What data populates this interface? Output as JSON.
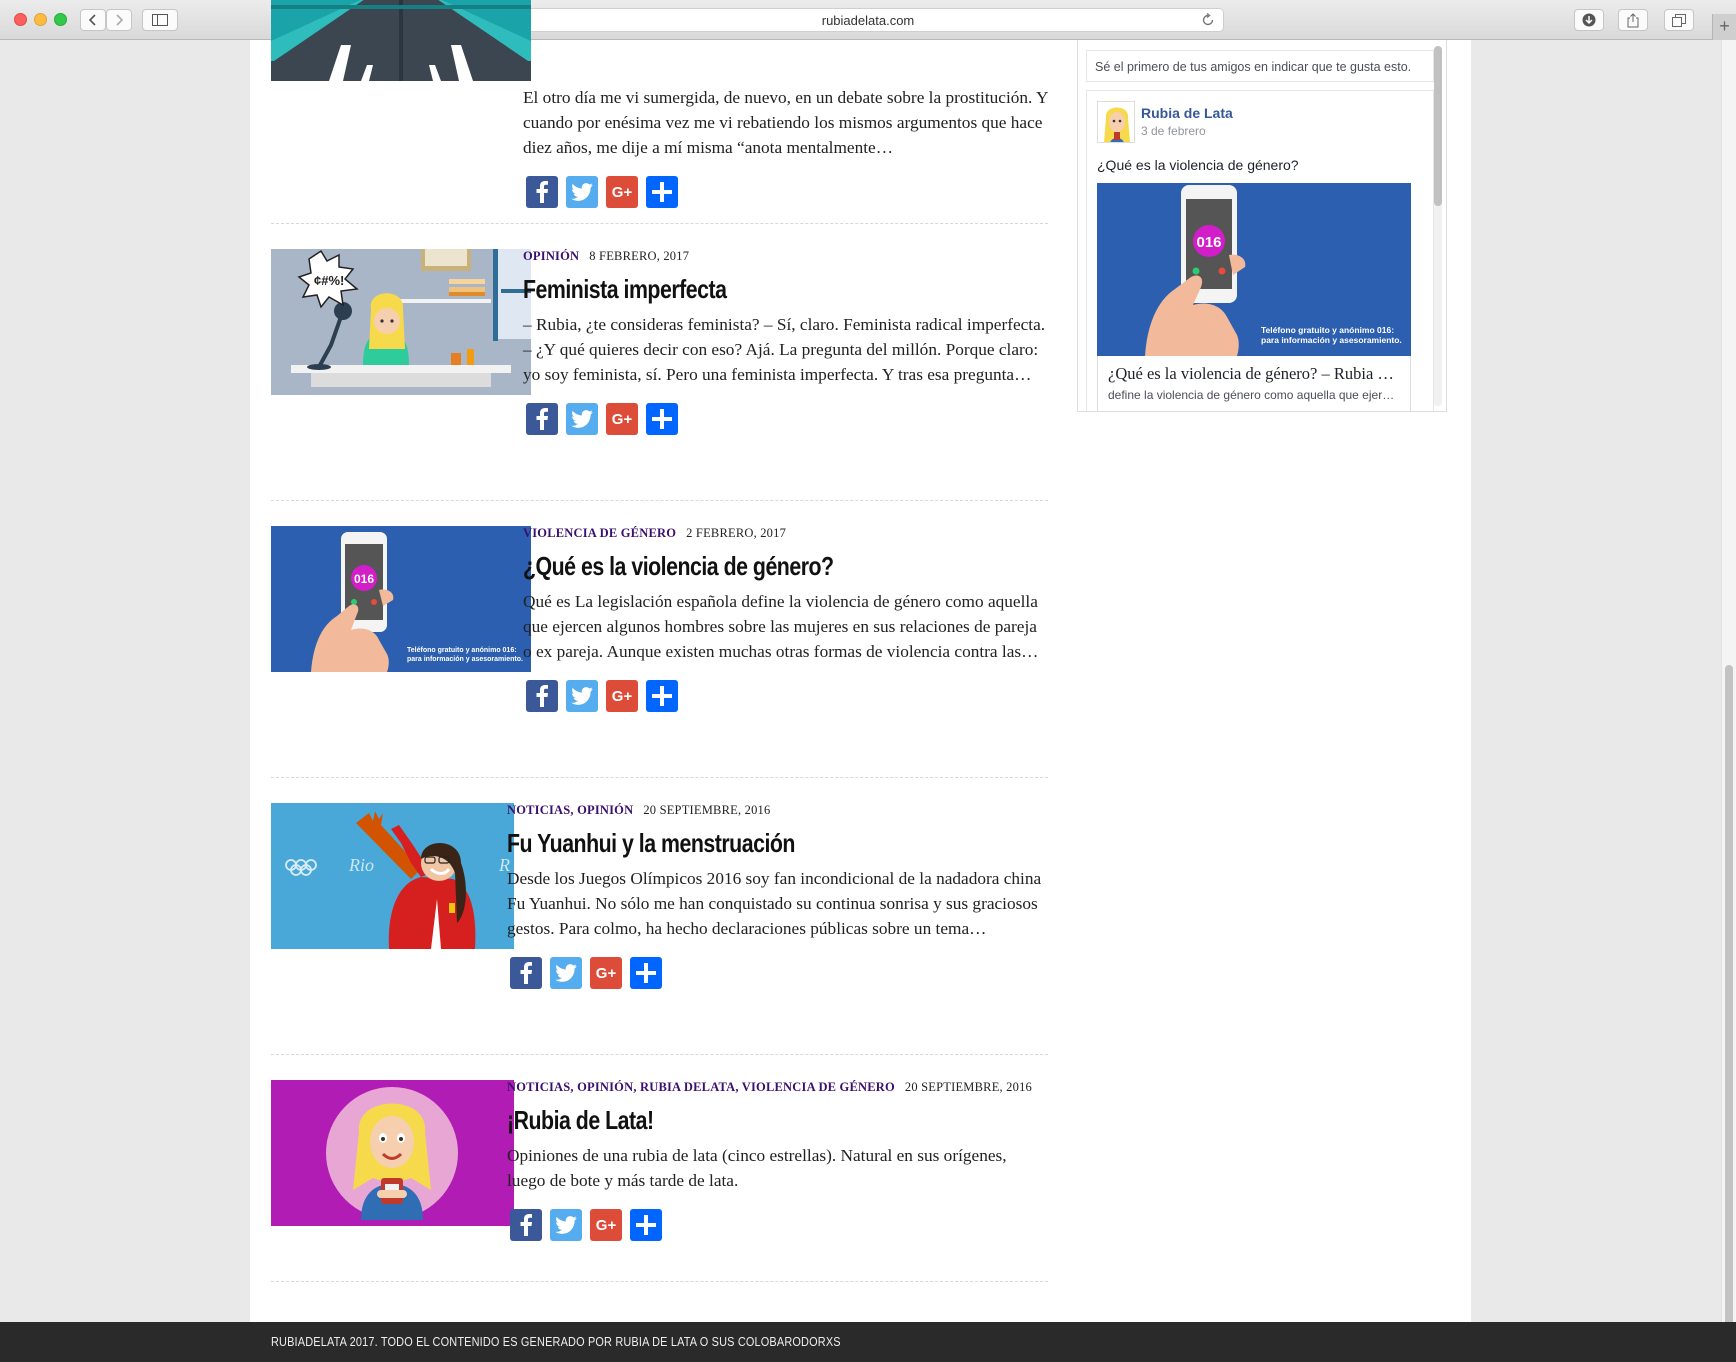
{
  "browser": {
    "url": "rubiadelata.com"
  },
  "posts": [
    {
      "categories": "",
      "date": "",
      "title": "",
      "excerpt": "El otro día me vi sumergida, de nuevo, en un debate sobre la prostitución. Y cuando por enésima vez me vi rebatiendo los mismos argumentos que hace diez años, me dije a mí misma “anota mentalmente…"
    },
    {
      "categories": "Opinión",
      "date": "8 febrero, 2017",
      "title": "Feminista imperfecta",
      "excerpt": "– Rubia, ¿te consideras feminista? – Sí, claro. Feminista radical imperfecta. – ¿Y qué quieres decir con eso? Ajá. La pregunta del millón. Porque claro: yo soy feminista, sí. Pero una feminista imperfecta. Y tras esa pregunta…"
    },
    {
      "categories": "Violencia de género",
      "date": "2 febrero, 2017",
      "title": "¿Qué es la violencia de género?",
      "excerpt": "Qué es La legislación española define la violencia de género como aquella que ejercen algunos hombres sobre las mujeres en sus relaciones de pareja o ex pareja. Aunque existen muchas otras formas de violencia contra las…"
    },
    {
      "categories": "Noticias, Opinión",
      "date": "20 septiembre, 2016",
      "title": "Fu Yuanhui y la menstruación",
      "excerpt": "Desde los Juegos Olímpicos 2016 soy fan incondicional de la nadadora china Fu Yuanhui. No sólo me han conquistado su continua sonrisa y sus graciosos gestos. Para colmo, ha hecho declaraciones públicas sobre un tema…"
    },
    {
      "categories": "Noticias, Opinión, Rubia delata, Violencia de género",
      "date": "20 septiembre, 2016",
      "title": "¡Rubia de Lata!",
      "excerpt": "Opiniones de una rubia de lata (cinco estrellas). Natural en sus orígenes, luego de bote y más tarde de lata."
    }
  ],
  "thumbs": {
    "phone_number": "016",
    "phone_caption_1": "Teléfono gratuito y anónimo 016:",
    "phone_caption_2": "para información y asesoramiento.",
    "comic_symbols": "¢#%!"
  },
  "share_labels": {
    "google": "G+"
  },
  "facebook_widget": {
    "friends_text": "Sé el primero de tus amigos en indicar que te gusta esto.",
    "page_name": "Rubia de Lata",
    "post_date": "3 de febrero",
    "post_text": "¿Qué es la violencia de género?",
    "link_title": "¿Qué es la violencia de género? – Rubia de Lata",
    "link_description": "define la violencia de género como aquella que ejercen algunos hombres sobre las mujeres"
  },
  "footer": {
    "text": "Rubiadelata 2017. Todo el contenido es generado por Rubia de Lata o sus colobarodorxs"
  },
  "colors": {
    "category": "#3a0f6e",
    "facebook": "#3b5998",
    "twitter": "#55acee",
    "google": "#dd4b39",
    "addtoany": "#0166ff"
  }
}
